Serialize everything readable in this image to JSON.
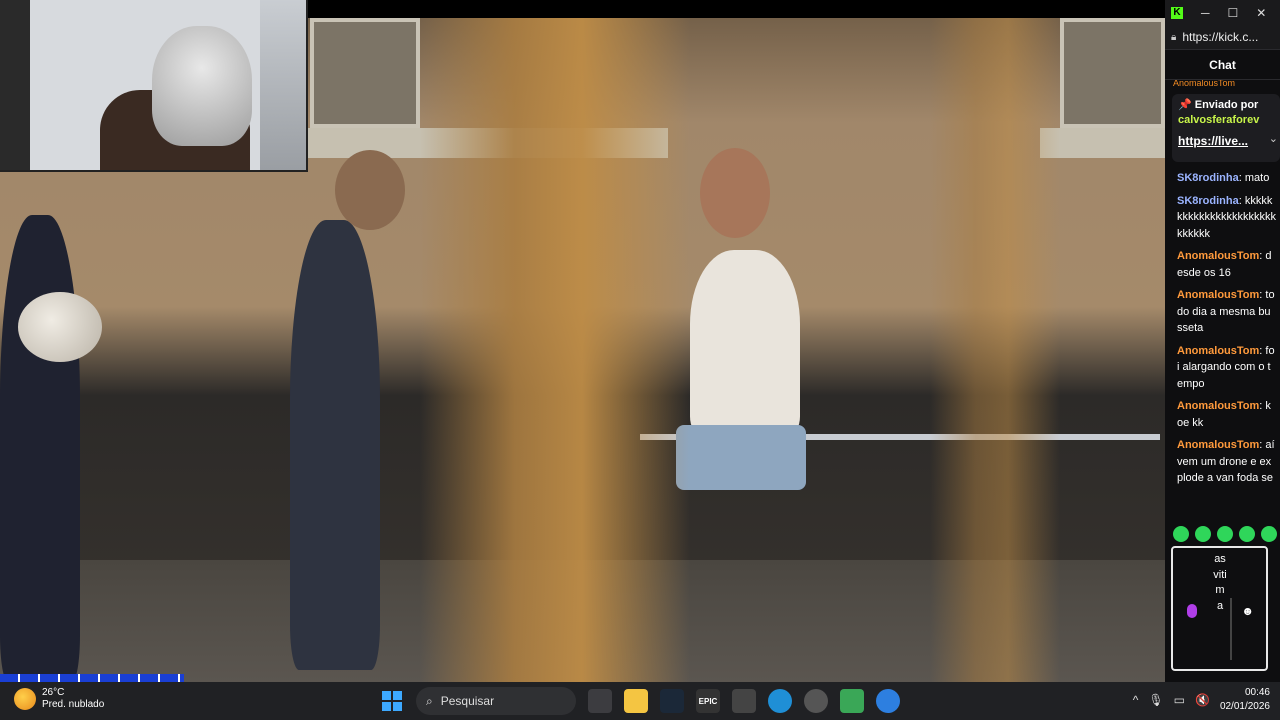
{
  "browser": {
    "url": "https://kick.c...",
    "minimize": "─",
    "maximize": "☐",
    "close": "✕"
  },
  "chat": {
    "title": "Chat",
    "pinned": {
      "cut_text": "AnomalousTom",
      "label": "📌 Enviado por",
      "user": "calvosferaforev",
      "link": "https://live...",
      "chevron": "⌄"
    },
    "messages": [
      {
        "user": "SK8rodinha",
        "text": "mato",
        "color": "blue"
      },
      {
        "user": "SK8rodinha",
        "text": "kkkkkkkkkkkkkkkkkkkkkkkkkkkkk",
        "color": "blue"
      },
      {
        "user": "AnomalousTom",
        "text": "desde os 16",
        "color": "orange"
      },
      {
        "user": "AnomalousTom",
        "text": "todo dia a mesma busseta",
        "color": "orange"
      },
      {
        "user": "AnomalousTom",
        "text": "foi alargando com o tempo",
        "color": "orange"
      },
      {
        "user": "AnomalousTom",
        "text": "koe kk",
        "color": "orange"
      },
      {
        "user": "AnomalousTom",
        "text": "aí vem um drone e explode a van foda se",
        "color": "orange"
      }
    ],
    "composer_text": "asvitima",
    "emoji_button": "☻",
    "accent": "#53fc18"
  },
  "taskbar": {
    "weather_temp": "26°C",
    "weather_desc": "Pred. nublado",
    "search_placeholder": "Pesquisar",
    "time": "00:46",
    "date": "02/01/2026",
    "chevron_up": "^",
    "mic": "🎙",
    "speaker_muted": "🔇"
  }
}
